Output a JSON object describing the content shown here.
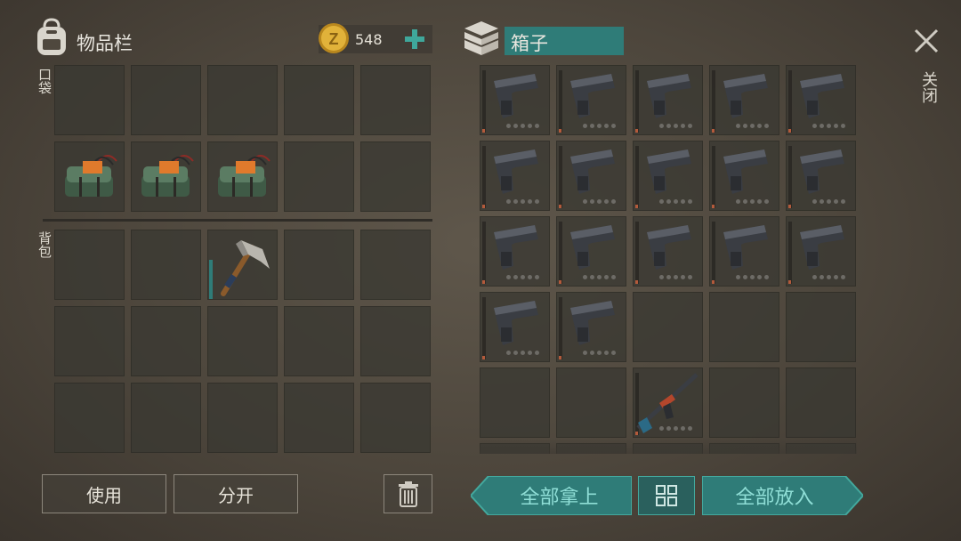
{
  "player": {
    "title": "物品栏",
    "coins": "548",
    "pocket_label": "口袋",
    "backpack_label": "背包"
  },
  "container": {
    "title": "箱子",
    "close_label": "关闭"
  },
  "buttons": {
    "use": "使用",
    "split": "分开",
    "take_all": "全部拿上",
    "put_all": "全部放入"
  },
  "icons": {
    "backpack": "backpack-icon",
    "coin": "coin-icon",
    "add": "plus-icon",
    "crate": "crate-icon",
    "close": "close-icon",
    "trash": "trash-icon",
    "sort": "grid-sort-icon"
  },
  "pocket_slots": [
    "",
    "",
    "",
    "",
    "",
    "c4-explosive",
    "c4-explosive",
    "c4-explosive",
    "",
    ""
  ],
  "backpack_slots": [
    "",
    "",
    "hatchet",
    "",
    "",
    "",
    "",
    "",
    "",
    "",
    "",
    "",
    "",
    "",
    ""
  ],
  "container_slots": [
    "pistol",
    "pistol",
    "pistol",
    "pistol",
    "pistol",
    "pistol",
    "pistol",
    "pistol",
    "pistol",
    "pistol",
    "pistol",
    "pistol",
    "pistol",
    "pistol",
    "pistol",
    "pistol",
    "pistol",
    "",
    "",
    "",
    "",
    "",
    "assault-rifle",
    "",
    ""
  ],
  "colors": {
    "accent_teal": "#2f7c78",
    "accent_text": "#8fded6",
    "coin_gold": "#e1b23a"
  }
}
